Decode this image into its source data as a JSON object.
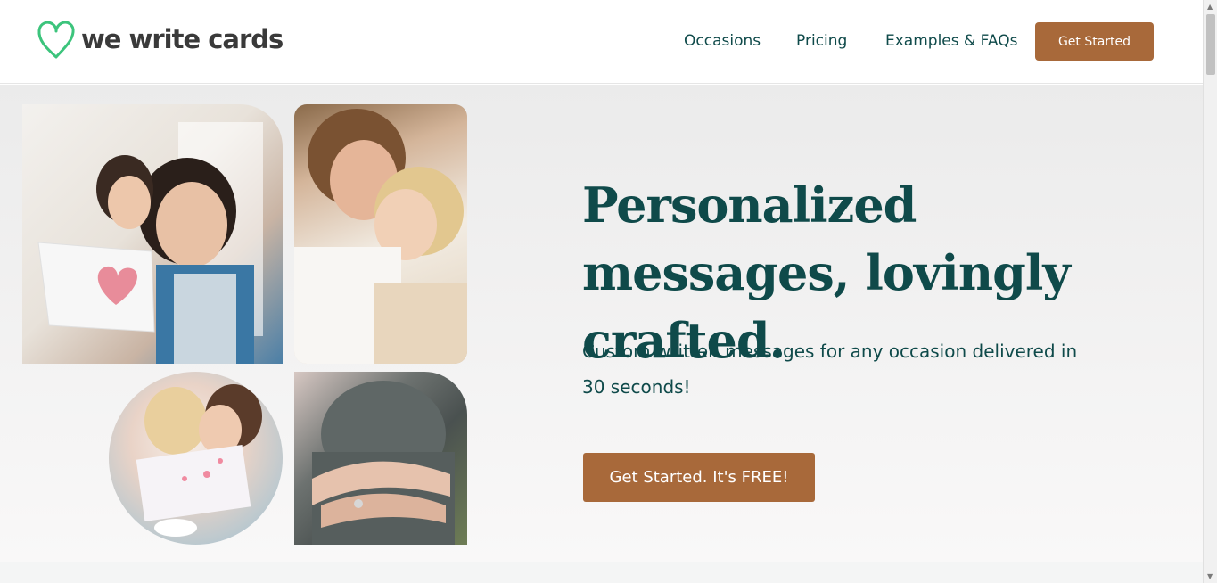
{
  "brand": {
    "name": "we write cards",
    "logo_icon": "heart-icon",
    "logo_color": "#3cc47c"
  },
  "nav": {
    "items": [
      {
        "label": "Occasions"
      },
      {
        "label": "Pricing"
      },
      {
        "label": "Examples & FAQs"
      }
    ],
    "cta_label": "Get Started"
  },
  "hero": {
    "headline": "Personalized messages, lovingly crafted.",
    "subtext": "Custom written messages for any occasion delivered in 30 seconds!",
    "cta_label": "Get Started. It's FREE!"
  },
  "colors": {
    "accent": "#a8693a",
    "text": "#0f4a4a"
  }
}
